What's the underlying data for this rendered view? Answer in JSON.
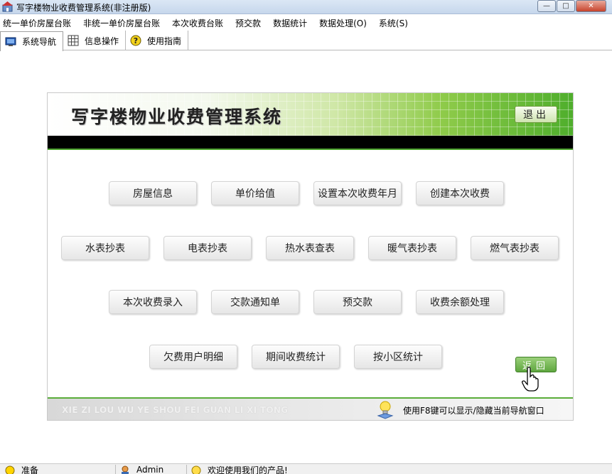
{
  "window": {
    "title": "写字楼物业收费管理系统(非注册版)",
    "min_glyph": "—",
    "max_glyph": "□",
    "close_glyph": "✕"
  },
  "menubar": {
    "items": [
      "统一单价房屋台账",
      "非统一单价房屋台账",
      "本次收费台账",
      "预交款",
      "数据统计",
      "数据处理(O)",
      "系统(S)"
    ]
  },
  "tabs": [
    {
      "label": "系统导航",
      "icon": "monitor-icon"
    },
    {
      "label": "信息操作",
      "icon": "grid-icon"
    },
    {
      "label": "使用指南",
      "icon": "help-icon"
    }
  ],
  "banner": {
    "title": "写字楼物业收费管理系统",
    "exit_label": "退出"
  },
  "nav": {
    "row1": [
      "房屋信息",
      "单价给值",
      "设置本次收费年月",
      "创建本次收费"
    ],
    "row2": [
      "水表抄表",
      "电表抄表",
      "热水表查表",
      "暖气表抄表",
      "燃气表抄表"
    ],
    "row3": [
      "本次收费录入",
      "交款通知单",
      "预交款",
      "收费余额处理"
    ],
    "row4": [
      "欠费用户明细",
      "期间收费统计",
      "按小区统计"
    ],
    "back_label": "返回"
  },
  "footer": {
    "pinyin": "XIE ZI LOU WU YE SHOU FEI GUAN LI XI TONG",
    "hint": "使用F8键可以显示/隐藏当前导航窗口"
  },
  "statusbar": {
    "status": "准备",
    "user": "Admin",
    "message": "欢迎使用我们的产品!"
  },
  "colors": {
    "accent_green": "#4ca32d",
    "back_button": "#6fb24c"
  }
}
